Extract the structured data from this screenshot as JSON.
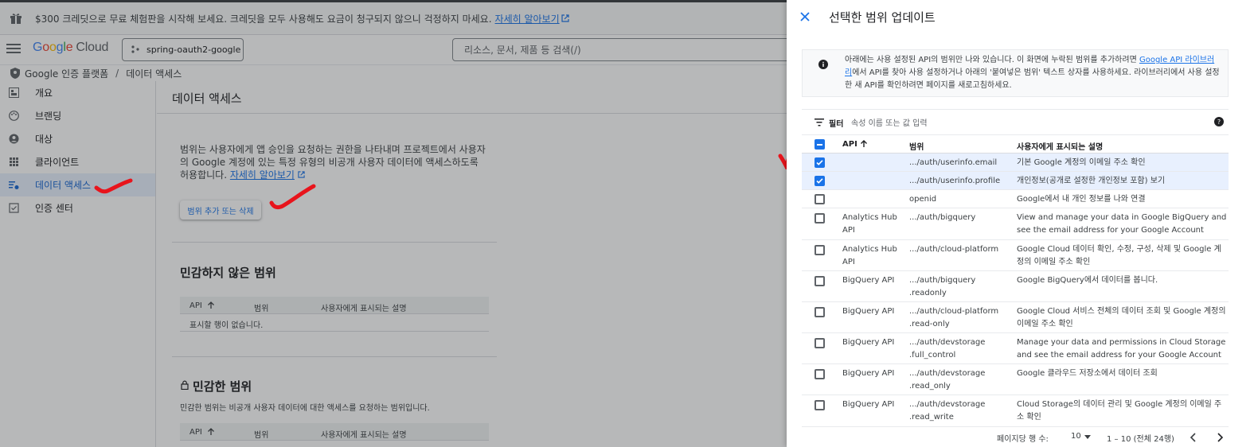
{
  "banner": {
    "text": "$300 크레딧으로 무료 체험판을 시작해 보세요. 크레딧을 모두 사용해도 요금이 청구되지 않으니 걱정하지 마세요.",
    "link": "자세히 알아보기"
  },
  "topbar": {
    "logo_google": [
      "G",
      "o",
      "o",
      "g",
      "l",
      "e"
    ],
    "logo_cloud": "Cloud",
    "project": "spring-oauth2-google",
    "search_placeholder": "리소스, 문서, 제품 등 검색(/)"
  },
  "breadcrumb": {
    "root": "Google 인증 플랫폼",
    "separator": "/",
    "current": "데이터 액세스"
  },
  "sidebar": {
    "items": [
      {
        "label": "개요",
        "icon": "dashboard-icon"
      },
      {
        "label": "브랜딩",
        "icon": "palette-icon"
      },
      {
        "label": "대상",
        "icon": "person-icon"
      },
      {
        "label": "클라이언트",
        "icon": "grid-icon"
      },
      {
        "label": "데이터 액세스",
        "icon": "data-access-icon",
        "active": true
      },
      {
        "label": "인증 센터",
        "icon": "verified-icon"
      }
    ]
  },
  "main": {
    "title": "데이터 액세스",
    "description": "범위는 사용자에게 앱 승인을 요청하는 권한을 나타내며 프로젝트에서 사용자의 Google 계정에 있는 특정 유형의 비공개 사용자 데이터에 액세스하도록 허용합니다.",
    "description_link": "자세히 알아보기",
    "add_button": "범위 추가 또는 삭제",
    "nonsensitive": {
      "title": "민감하지 않은 범위",
      "col_api": "API",
      "col_scope": "범위",
      "col_desc": "사용자에게 표시되는 설명",
      "empty": "표시할 행이 없습니다."
    },
    "sensitive": {
      "title": "민감한 범위",
      "subtitle": "민감한 범위는 비공개 사용자 데이터에 대한 액세스를 요청하는 범위입니다.",
      "col_api": "API",
      "col_scope": "범위",
      "col_desc": "사용자에게 표시되는 설명"
    }
  },
  "panel": {
    "title": "선택한 범위 업데이트",
    "info_text": "아래에는 사용 설정된 API의 범위만 나와 있습니다. 이 화면에 누락된 범위를 추가하려면",
    "info_link": "Google API 라이브러리",
    "info_text2": "에서 API를 찾아 사용 설정하거나 아래의 '붙여넣은 범위' 텍스트 상자를 사용하세요. 라이브러리에서 사용 설정한 새 API를 확인하려면 페이지를 새로고침하세요.",
    "filter_label": "필터",
    "filter_placeholder": "속성 이름 또는 값 입력",
    "columns": {
      "api": "API",
      "scope": "범위",
      "desc": "사용자에게 표시되는 설명"
    },
    "rows": [
      {
        "api": "",
        "scope": ".../auth/userinfo.email",
        "desc": "기본 Google 계정의 이메일 주소 확인",
        "checked": true
      },
      {
        "api": "",
        "scope": ".../auth/userinfo.profile",
        "desc": "개인정보(공개로 설정한 개인정보 포함) 보기",
        "checked": true
      },
      {
        "api": "",
        "scope": "openid",
        "desc": "Google에서 내 개인 정보를 나와 연결",
        "checked": false
      },
      {
        "api": "Analytics Hub API",
        "scope": ".../auth/bigquery",
        "desc": "View and manage your data in Google BigQuery and see the email address for your Google Account",
        "checked": false
      },
      {
        "api": "Analytics Hub API",
        "scope": ".../auth/cloud-platform",
        "desc": "Google Cloud 데이터 확인, 수정, 구성, 삭제 및 Google 계정의 이메일 주소 확인",
        "checked": false
      },
      {
        "api": "BigQuery API",
        "scope": ".../auth/bigquery .readonly",
        "desc": "Google BigQuery에서 데이터를 봅니다.",
        "checked": false
      },
      {
        "api": "BigQuery API",
        "scope": ".../auth/cloud-platform .read-only",
        "desc": "Google Cloud 서비스 전체의 데이터 조회 및 Google 계정의 이메일 주소 확인",
        "checked": false
      },
      {
        "api": "BigQuery API",
        "scope": ".../auth/devstorage .full_control",
        "desc": "Manage your data and permissions in Cloud Storage and see the email address for your Google Account",
        "checked": false
      },
      {
        "api": "BigQuery API",
        "scope": ".../auth/devstorage .read_only",
        "desc": "Google 클라우드 저장소에서 데이터 조회",
        "checked": false
      },
      {
        "api": "BigQuery API",
        "scope": ".../auth/devstorage .read_write",
        "desc": "Cloud Storage의 데이터 관리 및 Google 계정의 이메일 주소 확인",
        "checked": false
      }
    ],
    "footer": {
      "rows_per_page_label": "페이지당 행 수:",
      "rows_per_page": "10",
      "range": "1 – 10 (전체 24행)"
    }
  },
  "colors": {
    "accent": "#1a73e8",
    "annotation": "#e8141c"
  }
}
